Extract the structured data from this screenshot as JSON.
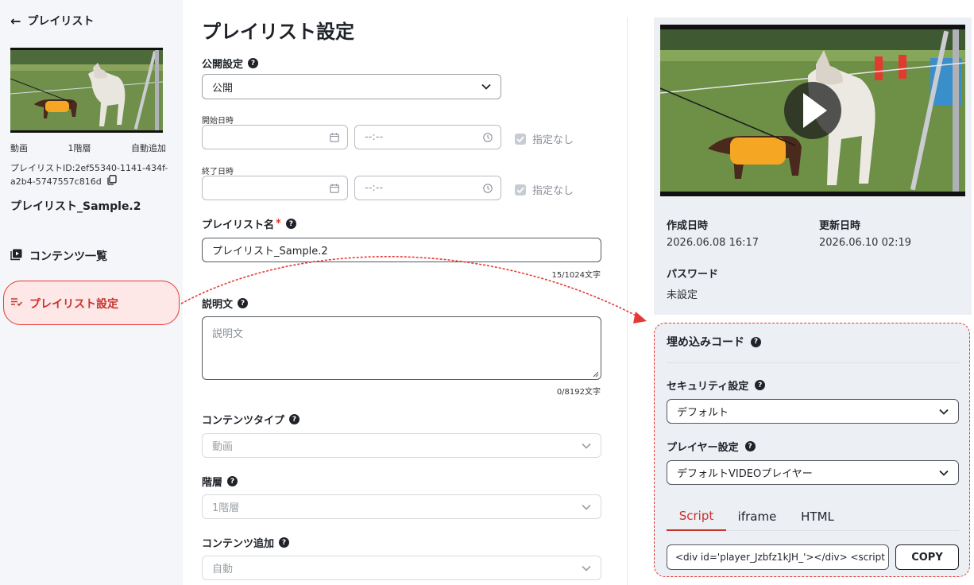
{
  "sidebar": {
    "back_label": "プレイリスト",
    "type_label": "動画",
    "level_label": "1階層",
    "add_label": "自動追加",
    "playlist_id_line1": "プレイリストID:2ef55340-1141-434f-",
    "playlist_id_line2": "a2b4-5747557c816d",
    "playlist_name": "プレイリスト_Sample.2",
    "nav": {
      "contents": "コンテンツ一覧",
      "settings": "プレイリスト設定"
    }
  },
  "main": {
    "title": "プレイリスト設定",
    "visibility": {
      "label": "公開設定",
      "value": "公開"
    },
    "start": {
      "label": "開始日時",
      "date_value": "",
      "time_placeholder": "--:--",
      "unset_label": "指定なし",
      "unset_checked": true
    },
    "end": {
      "label": "終了日時",
      "date_value": "",
      "time_placeholder": "--:--",
      "unset_label": "指定なし",
      "unset_checked": true
    },
    "name": {
      "label": "プレイリスト名",
      "required_mark": "*",
      "value": "プレイリスト_Sample.2",
      "counter": "15/1024文字"
    },
    "description": {
      "label": "説明文",
      "placeholder": "説明文",
      "counter": "0/8192文字"
    },
    "content_type": {
      "label": "コンテンツタイプ",
      "value": "動画"
    },
    "level": {
      "label": "階層",
      "value": "1階層"
    },
    "content_add": {
      "label": "コンテンツ追加",
      "value": "自動"
    }
  },
  "right": {
    "created": {
      "label": "作成日時",
      "value": "2026.06.08 16:17"
    },
    "updated": {
      "label": "更新日時",
      "value": "2026.06.10 02:19"
    },
    "password": {
      "label": "パスワード",
      "value": "未設定"
    },
    "embed": {
      "title": "埋め込みコード",
      "security": {
        "label": "セキュリティ設定",
        "value": "デフォルト"
      },
      "player": {
        "label": "プレイヤー設定",
        "value": "デフォルトVIDEOプレイヤー"
      },
      "tabs": [
        "Script",
        "iframe",
        "HTML"
      ],
      "active_tab": "Script",
      "code": "<div id='player_Jzbfz1kJH_'></div>  <script",
      "copy_label": "COPY"
    }
  },
  "colors": {
    "accent": "#c8322b",
    "annotation": "#e53935",
    "panel_bg": "#eceff4",
    "sidebar_bg": "#f4f6f9"
  }
}
